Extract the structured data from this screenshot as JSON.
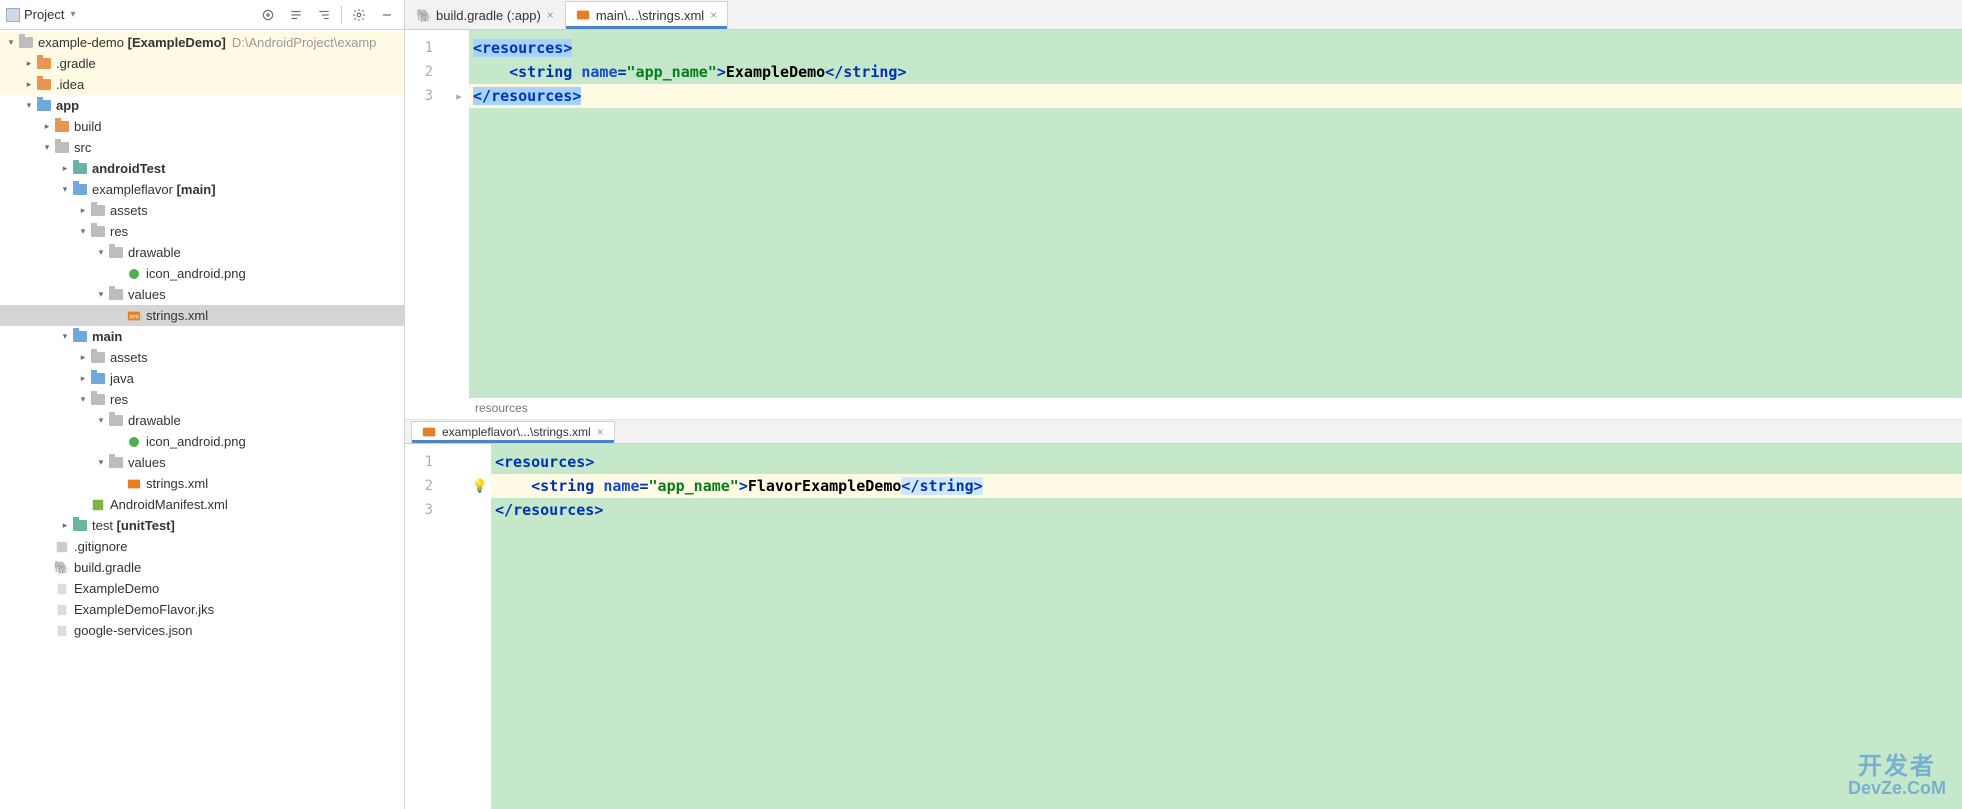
{
  "sidebar": {
    "title": "Project",
    "toolbar": {
      "target": "⊕",
      "collapse": "⇐",
      "expand": "⇒",
      "gear": "⚙",
      "minimize": "—"
    }
  },
  "tree": {
    "root_name": "example-demo",
    "root_bold": "[ExampleDemo]",
    "root_path": "D:\\AndroidProject\\examp",
    "gradle": ".gradle",
    "idea": ".idea",
    "app": "app",
    "build": "build",
    "src": "src",
    "androidTest": "androidTest",
    "exampleflavor": "exampleflavor",
    "exampleflavor_tag": "[main]",
    "assets1": "assets",
    "res1": "res",
    "drawable1": "drawable",
    "icon_android1": "icon_android.png",
    "values1": "values",
    "strings1": "strings.xml",
    "main": "main",
    "assets2": "assets",
    "java": "java",
    "res2": "res",
    "drawable2": "drawable",
    "icon_android2": "icon_android.png",
    "values2": "values",
    "strings2": "strings.xml",
    "manifest": "AndroidManifest.xml",
    "test": "test",
    "test_tag": "[unitTest]",
    "gitignore": ".gitignore",
    "build_gradle": "build.gradle",
    "ExampleDemo": "ExampleDemo",
    "ExampleDemoFlavor": "ExampleDemoFlavor.jks",
    "google_services": "google-services.json"
  },
  "tabs": {
    "t1": "build.gradle (:app)",
    "t2": "main\\...\\strings.xml"
  },
  "editor_top": {
    "lines": [
      "1",
      "2",
      "3"
    ],
    "l1_tag": "resources",
    "l2_tag": "string",
    "l2_attr": "name",
    "l2_val": "\"app_name\"",
    "l2_text": "ExampleDemo",
    "l3_tag": "resources",
    "breadcrumb": "resources"
  },
  "minor_tab": "exampleflavor\\...\\strings.xml",
  "editor_bottom": {
    "lines": [
      "1",
      "2",
      "3"
    ],
    "l1_tag": "resources",
    "l2_tag": "string",
    "l2_attr": "name",
    "l2_val": "\"app_name\"",
    "l2_text": "FlavorExampleDemo",
    "l3_tag": "resources"
  },
  "watermark": {
    "cn": "开发者",
    "en": "DevZe.CoM"
  }
}
